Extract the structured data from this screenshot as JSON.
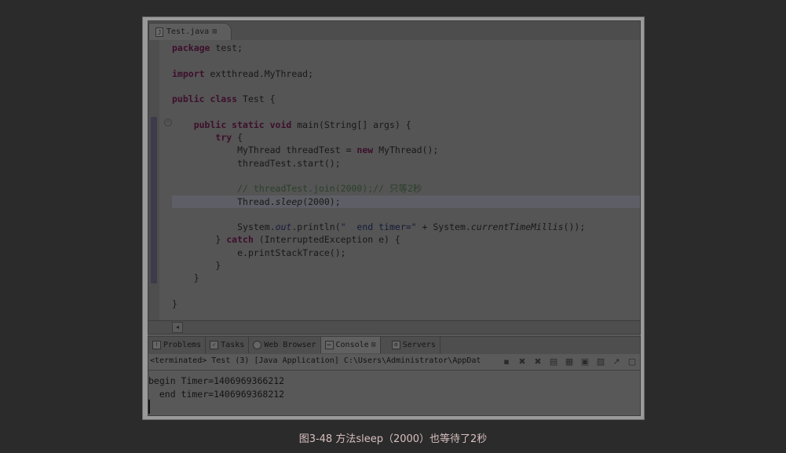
{
  "editor": {
    "tab_label": "Test.java",
    "file_icon_label": "J",
    "lines": {
      "l1_kw": "package",
      "l1_rest": " test;",
      "l3_kw": "import",
      "l3_rest": " extthread.MyThread;",
      "l5_kw": "public class",
      "l5_rest": " Test {",
      "l7_kw": "public static void",
      "l7_rest": " main(String[] args) {",
      "l8_kw": "try",
      "l8_rest": " {",
      "l9_a": "MyThread threadTest = ",
      "l9_kw": "new",
      "l9_b": " MyThread();",
      "l10": "threadTest.start();",
      "l12_comment": "// threadTest.join(2000);// 只等2秒",
      "l13_a": "Thread.",
      "l13_it": "sleep",
      "l13_b": "(2000);",
      "l15_a": "System.",
      "l15_out": "out",
      "l15_b": ".println(",
      "l15_str": "\"  end timer=\"",
      "l15_c": " + System.",
      "l15_ct": "currentTimeMillis",
      "l15_d": "());",
      "l16_a": "} ",
      "l16_kw": "catch",
      "l16_b": " (InterruptedException e) {",
      "l17": "e.printStackTrace();",
      "l18": "}",
      "l19": "}",
      "l21": "}"
    }
  },
  "console_view": {
    "tabs": [
      {
        "label": "Problems",
        "icon": "problems-icon"
      },
      {
        "label": "Tasks",
        "icon": "tasks-icon"
      },
      {
        "label": "Web Browser",
        "icon": "globe-icon"
      },
      {
        "label": "Console",
        "icon": "console-icon"
      },
      {
        "label": "Servers",
        "icon": "servers-icon"
      }
    ],
    "status": "<terminated> Test (3) [Java Application] C:\\Users\\Administrator\\AppDat",
    "output_line1": "begin Timer=1406969366212",
    "output_line2": "  end timer=1406969368212"
  },
  "caption": "图3-48   方法sleep（2000）也等待了2秒"
}
